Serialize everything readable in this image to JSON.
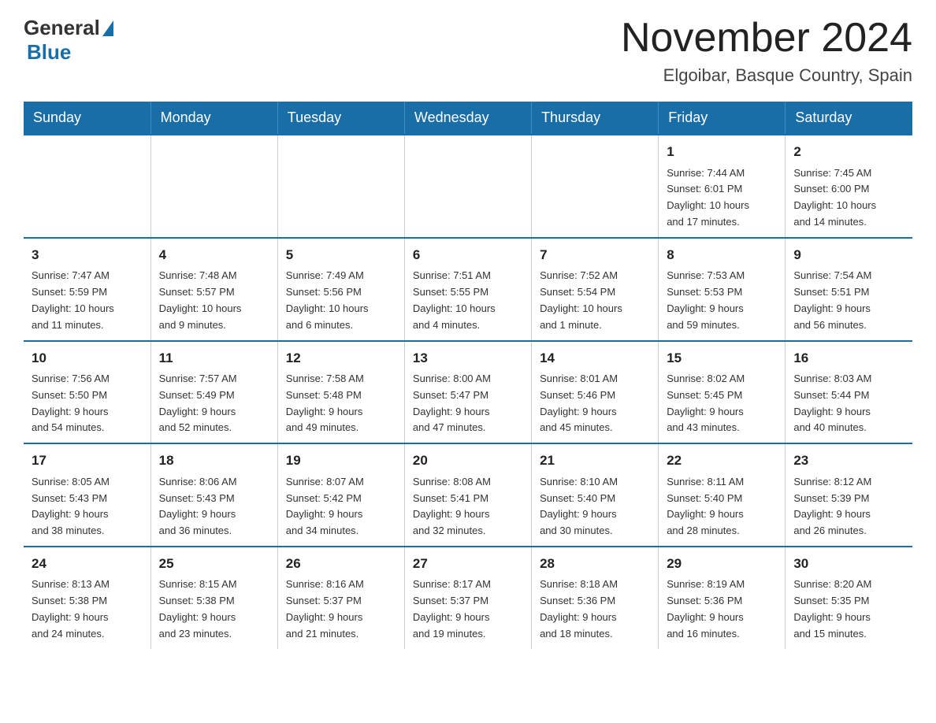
{
  "header": {
    "logo_general": "General",
    "logo_blue": "Blue",
    "month_title": "November 2024",
    "location": "Elgoibar, Basque Country, Spain"
  },
  "weekdays": [
    "Sunday",
    "Monday",
    "Tuesday",
    "Wednesday",
    "Thursday",
    "Friday",
    "Saturday"
  ],
  "weeks": [
    [
      {
        "day": "",
        "info": ""
      },
      {
        "day": "",
        "info": ""
      },
      {
        "day": "",
        "info": ""
      },
      {
        "day": "",
        "info": ""
      },
      {
        "day": "",
        "info": ""
      },
      {
        "day": "1",
        "info": "Sunrise: 7:44 AM\nSunset: 6:01 PM\nDaylight: 10 hours\nand 17 minutes."
      },
      {
        "day": "2",
        "info": "Sunrise: 7:45 AM\nSunset: 6:00 PM\nDaylight: 10 hours\nand 14 minutes."
      }
    ],
    [
      {
        "day": "3",
        "info": "Sunrise: 7:47 AM\nSunset: 5:59 PM\nDaylight: 10 hours\nand 11 minutes."
      },
      {
        "day": "4",
        "info": "Sunrise: 7:48 AM\nSunset: 5:57 PM\nDaylight: 10 hours\nand 9 minutes."
      },
      {
        "day": "5",
        "info": "Sunrise: 7:49 AM\nSunset: 5:56 PM\nDaylight: 10 hours\nand 6 minutes."
      },
      {
        "day": "6",
        "info": "Sunrise: 7:51 AM\nSunset: 5:55 PM\nDaylight: 10 hours\nand 4 minutes."
      },
      {
        "day": "7",
        "info": "Sunrise: 7:52 AM\nSunset: 5:54 PM\nDaylight: 10 hours\nand 1 minute."
      },
      {
        "day": "8",
        "info": "Sunrise: 7:53 AM\nSunset: 5:53 PM\nDaylight: 9 hours\nand 59 minutes."
      },
      {
        "day": "9",
        "info": "Sunrise: 7:54 AM\nSunset: 5:51 PM\nDaylight: 9 hours\nand 56 minutes."
      }
    ],
    [
      {
        "day": "10",
        "info": "Sunrise: 7:56 AM\nSunset: 5:50 PM\nDaylight: 9 hours\nand 54 minutes."
      },
      {
        "day": "11",
        "info": "Sunrise: 7:57 AM\nSunset: 5:49 PM\nDaylight: 9 hours\nand 52 minutes."
      },
      {
        "day": "12",
        "info": "Sunrise: 7:58 AM\nSunset: 5:48 PM\nDaylight: 9 hours\nand 49 minutes."
      },
      {
        "day": "13",
        "info": "Sunrise: 8:00 AM\nSunset: 5:47 PM\nDaylight: 9 hours\nand 47 minutes."
      },
      {
        "day": "14",
        "info": "Sunrise: 8:01 AM\nSunset: 5:46 PM\nDaylight: 9 hours\nand 45 minutes."
      },
      {
        "day": "15",
        "info": "Sunrise: 8:02 AM\nSunset: 5:45 PM\nDaylight: 9 hours\nand 43 minutes."
      },
      {
        "day": "16",
        "info": "Sunrise: 8:03 AM\nSunset: 5:44 PM\nDaylight: 9 hours\nand 40 minutes."
      }
    ],
    [
      {
        "day": "17",
        "info": "Sunrise: 8:05 AM\nSunset: 5:43 PM\nDaylight: 9 hours\nand 38 minutes."
      },
      {
        "day": "18",
        "info": "Sunrise: 8:06 AM\nSunset: 5:43 PM\nDaylight: 9 hours\nand 36 minutes."
      },
      {
        "day": "19",
        "info": "Sunrise: 8:07 AM\nSunset: 5:42 PM\nDaylight: 9 hours\nand 34 minutes."
      },
      {
        "day": "20",
        "info": "Sunrise: 8:08 AM\nSunset: 5:41 PM\nDaylight: 9 hours\nand 32 minutes."
      },
      {
        "day": "21",
        "info": "Sunrise: 8:10 AM\nSunset: 5:40 PM\nDaylight: 9 hours\nand 30 minutes."
      },
      {
        "day": "22",
        "info": "Sunrise: 8:11 AM\nSunset: 5:40 PM\nDaylight: 9 hours\nand 28 minutes."
      },
      {
        "day": "23",
        "info": "Sunrise: 8:12 AM\nSunset: 5:39 PM\nDaylight: 9 hours\nand 26 minutes."
      }
    ],
    [
      {
        "day": "24",
        "info": "Sunrise: 8:13 AM\nSunset: 5:38 PM\nDaylight: 9 hours\nand 24 minutes."
      },
      {
        "day": "25",
        "info": "Sunrise: 8:15 AM\nSunset: 5:38 PM\nDaylight: 9 hours\nand 23 minutes."
      },
      {
        "day": "26",
        "info": "Sunrise: 8:16 AM\nSunset: 5:37 PM\nDaylight: 9 hours\nand 21 minutes."
      },
      {
        "day": "27",
        "info": "Sunrise: 8:17 AM\nSunset: 5:37 PM\nDaylight: 9 hours\nand 19 minutes."
      },
      {
        "day": "28",
        "info": "Sunrise: 8:18 AM\nSunset: 5:36 PM\nDaylight: 9 hours\nand 18 minutes."
      },
      {
        "day": "29",
        "info": "Sunrise: 8:19 AM\nSunset: 5:36 PM\nDaylight: 9 hours\nand 16 minutes."
      },
      {
        "day": "30",
        "info": "Sunrise: 8:20 AM\nSunset: 5:35 PM\nDaylight: 9 hours\nand 15 minutes."
      }
    ]
  ]
}
